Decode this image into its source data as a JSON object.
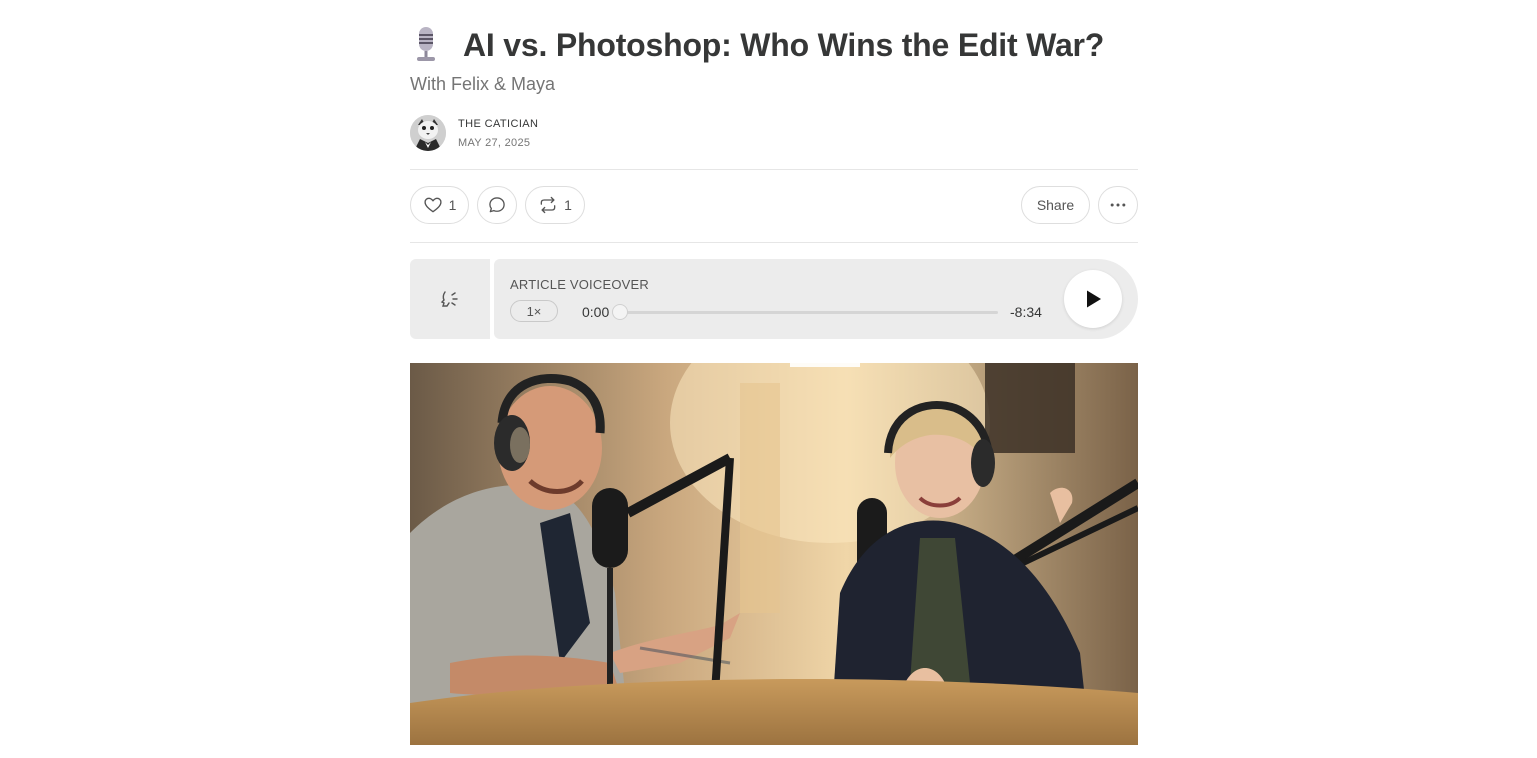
{
  "post": {
    "title": "AI vs. Photoshop: Who Wins the Edit War?",
    "subtitle": "With Felix & Maya",
    "title_icon": "studio-microphone-emoji"
  },
  "byline": {
    "author": "THE CATICIAN",
    "date": "MAY 27, 2025",
    "avatar_icon": "cat-in-suit-avatar"
  },
  "actions": {
    "like_count": "1",
    "restack_count": "1",
    "share_label": "Share",
    "icons": [
      "heart-icon",
      "comment-icon",
      "restack-icon",
      "more-icon"
    ]
  },
  "voiceover": {
    "label": "ARTICLE VOICEOVER",
    "speed": "1×",
    "current_time": "0:00",
    "remaining_time": "-8:34",
    "progress": 0
  },
  "hero_image": {
    "description_icon": "podcast-hosts-photo"
  },
  "colors": {
    "text": "#363737",
    "muted": "#757575",
    "player_bg": "#ececec",
    "divider": "#e6e6e6"
  }
}
